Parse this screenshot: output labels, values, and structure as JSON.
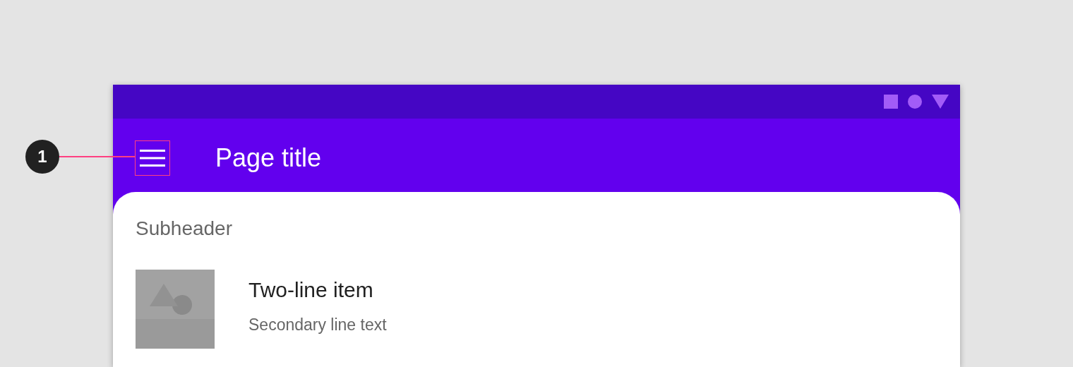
{
  "callout": {
    "label": "1"
  },
  "app_bar": {
    "title": "Page title"
  },
  "list": {
    "subheader": "Subheader",
    "items": [
      {
        "primary": "Two-line item",
        "secondary": "Secondary line text"
      }
    ]
  }
}
